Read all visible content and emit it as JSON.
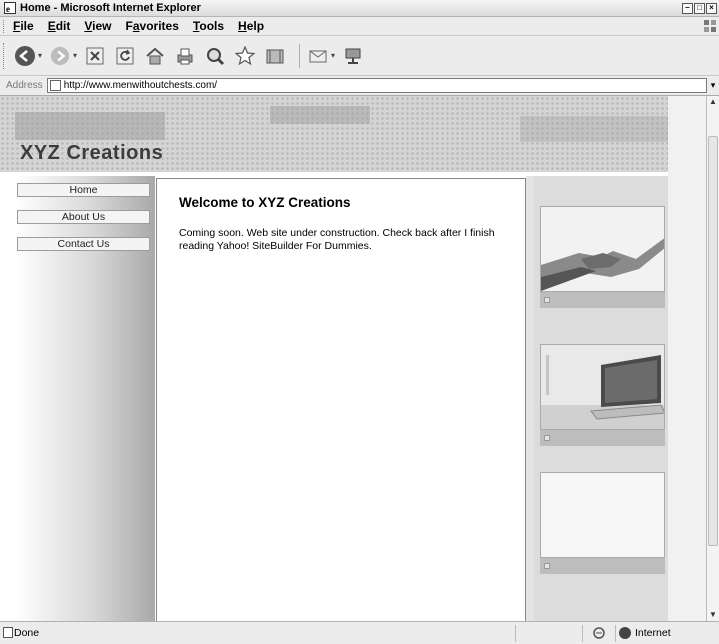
{
  "window": {
    "title": "Home - Microsoft Internet Explorer"
  },
  "menu": [
    {
      "label": "File",
      "key": "F",
      "rest": "ile"
    },
    {
      "label": "Edit",
      "key": "E",
      "rest": "dit"
    },
    {
      "label": "View",
      "key": "V",
      "rest": "iew"
    },
    {
      "label": "Favorites",
      "pre": "F",
      "key": "a",
      "rest": "vorites"
    },
    {
      "label": "Tools",
      "key": "T",
      "rest": "ools"
    },
    {
      "label": "Help",
      "key": "H",
      "rest": "elp"
    }
  ],
  "address": {
    "label": "Address",
    "url": "http://www.menwithoutchests.com/"
  },
  "site": {
    "title": "XYZ Creations",
    "nav": [
      "Home",
      "About Us",
      "Contact Us"
    ],
    "heading": "Welcome to XYZ Creations",
    "body": "Coming soon.  Web site under construction. Check back after I finish reading Yahoo! SiteBuilder For Dummies.",
    "images": [
      "handshake-photo",
      "laptop-photo",
      "empty-placeholder"
    ]
  },
  "status": {
    "text": "Done",
    "zone": "Internet"
  }
}
